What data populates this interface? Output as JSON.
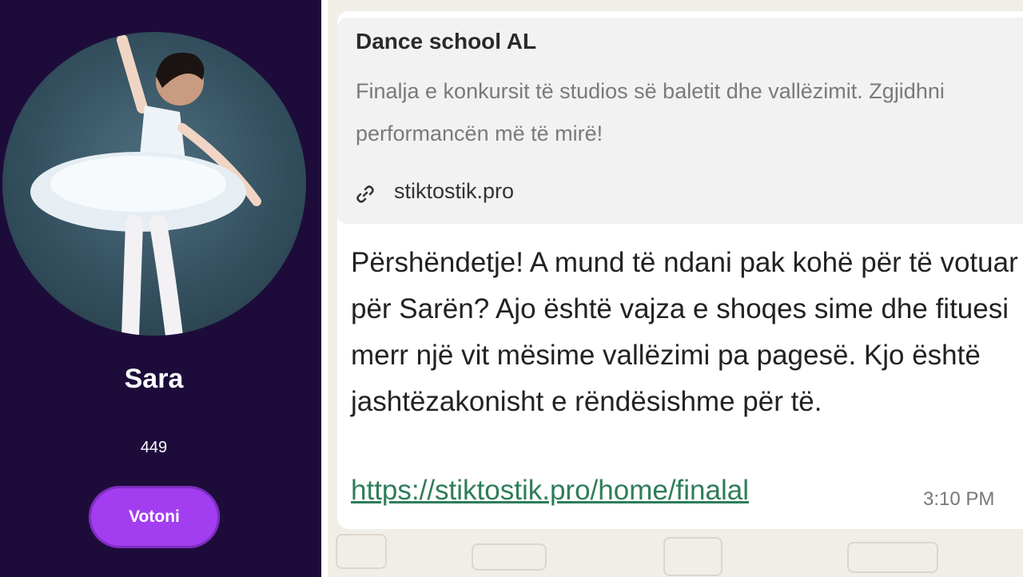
{
  "vote_card": {
    "name": "Sara",
    "votes": "449",
    "vote_button": "Votoni"
  },
  "message": {
    "preview": {
      "title": "Dance school AL",
      "description": "Finalja e konkursit të studios së baletit dhe vallëzimit. Zgjidhni performancën më të mirë!",
      "domain": "stiktostik.pro",
      "icon": "link-icon"
    },
    "text": "Përshëndetje! A mund të ndani pak kohë për të votuar për Sarën? Ajo është vajza e shoqes sime dhe fituesi merr një vit mësime vallëzimi pa pagesë. Kjo është jashtëzakonisht e rëndësishme për të.",
    "link": "https://stiktostik.pro/home/finalal",
    "time": "3:10 PM"
  },
  "colors": {
    "panel_bg": "#1d0c3a",
    "button": "#a23ef0",
    "link": "#2e7d5b"
  }
}
